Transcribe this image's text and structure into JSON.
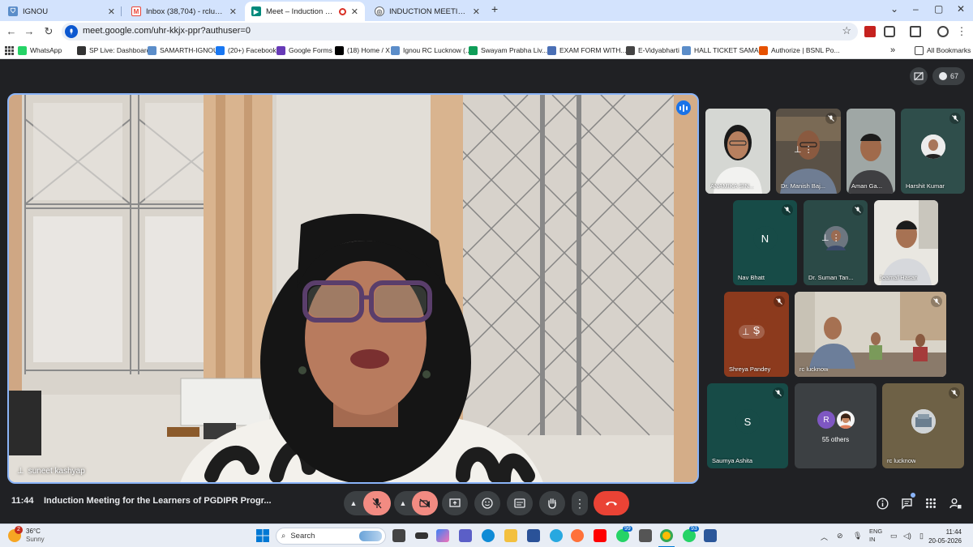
{
  "browser": {
    "tabs": [
      {
        "title": "IGNOU",
        "icon": "ignou-favicon",
        "color": "#5b8dc9"
      },
      {
        "title": "Inbox (38,704) - rclucknow@ign",
        "icon": "gmail-icon",
        "color": "#ea4335"
      },
      {
        "title": "Meet – Induction Meeting f",
        "icon": "meet-icon",
        "color": "#00897b",
        "recording": true
      },
      {
        "title": "INDUCTION MEETING - PGDIPR",
        "icon": "globe-icon",
        "color": "#5f6368"
      }
    ],
    "new_tab": "+",
    "window_controls": {
      "minimize": "–",
      "maximize": "▢",
      "close": "✕",
      "dropdown": "⌄"
    },
    "url": "meet.google.com/uhr-kkjx-ppr?authuser=0",
    "bookmarks": [
      {
        "label": "WhatsApp",
        "icon": "whatsapp-icon",
        "color": "#25d366"
      },
      {
        "label": "SP Live: Dashboard",
        "icon": "sp-icon",
        "color": "#333333"
      },
      {
        "label": "SAMARTH-IGNOU",
        "icon": "samarth-icon",
        "color": "#5b8dc9"
      },
      {
        "label": "(20+) Facebook",
        "icon": "facebook-icon",
        "color": "#1877f2"
      },
      {
        "label": "Google Forms",
        "icon": "forms-icon",
        "color": "#673ab7"
      },
      {
        "label": "(18) Home / X",
        "icon": "x-icon",
        "color": "#000000"
      },
      {
        "label": "Ignou RC Lucknow (...",
        "icon": "ignou-favicon",
        "color": "#5b8dc9"
      },
      {
        "label": "Swayam Prabha Liv...",
        "icon": "swayam-icon",
        "color": "#0f9d58"
      },
      {
        "label": "EXAM FORM WITH...",
        "icon": "exam-icon",
        "color": "#4a6fb5"
      },
      {
        "label": "E-Vidyabharti",
        "icon": "evidya-icon",
        "color": "#444444"
      },
      {
        "label": "HALL TICKET SAMA...",
        "icon": "hallticket-icon",
        "color": "#5b8dc9"
      },
      {
        "label": "Authorize | BSNL Po...",
        "icon": "bsnl-icon",
        "color": "#e65100"
      }
    ],
    "more_bookmarks": "»",
    "all_bookmarks": "All Bookmarks"
  },
  "meet": {
    "participant_count": "67",
    "main_speaker": "suneet kashyap",
    "tiles": [
      {
        "name": "ANAMIKA SIN...",
        "type": "video",
        "muted": false
      },
      {
        "name": "Dr. Manish Baj...",
        "type": "video",
        "muted": true
      },
      {
        "name": "Aman Ga...",
        "type": "video",
        "muted": false
      },
      {
        "name": "Harshit Kumar",
        "type": "avatar",
        "muted": true
      },
      {
        "name": "Nav Bhatt",
        "type": "letter",
        "letter": "N",
        "muted": true
      },
      {
        "name": "Dr. Suman Tan...",
        "type": "avatar",
        "muted": true
      },
      {
        "name": "Jeamal Hasan",
        "type": "video",
        "muted": false
      },
      {
        "name": "Shreya Pandey",
        "type": "letter",
        "letter": "S",
        "muted": true
      },
      {
        "name": "rc lucknow",
        "type": "video",
        "muted": true
      },
      {
        "name": "Saumya Ashita",
        "type": "letter",
        "letter": "S",
        "muted": true
      },
      {
        "name": "55 others",
        "type": "others",
        "letter": "R",
        "muted": false
      },
      {
        "name": "rc lucknow",
        "type": "video",
        "muted": true
      }
    ],
    "time": "11:44",
    "title": "Induction Meeting for the Learners of PGDIPR Progr...",
    "notification_badge": ""
  },
  "taskbar": {
    "weather_temp": "36°C",
    "weather_desc": "Sunny",
    "weather_badge": "2",
    "search_placeholder": "Search",
    "lang1": "ENG",
    "lang2": "IN",
    "time": "11:44",
    "date": "20-05-2026",
    "badge_a": "99",
    "badge_b": "93"
  },
  "colors": {
    "accent": "#8ab4f8",
    "end_call": "#ea4335",
    "muted_red": "#f28b82"
  }
}
